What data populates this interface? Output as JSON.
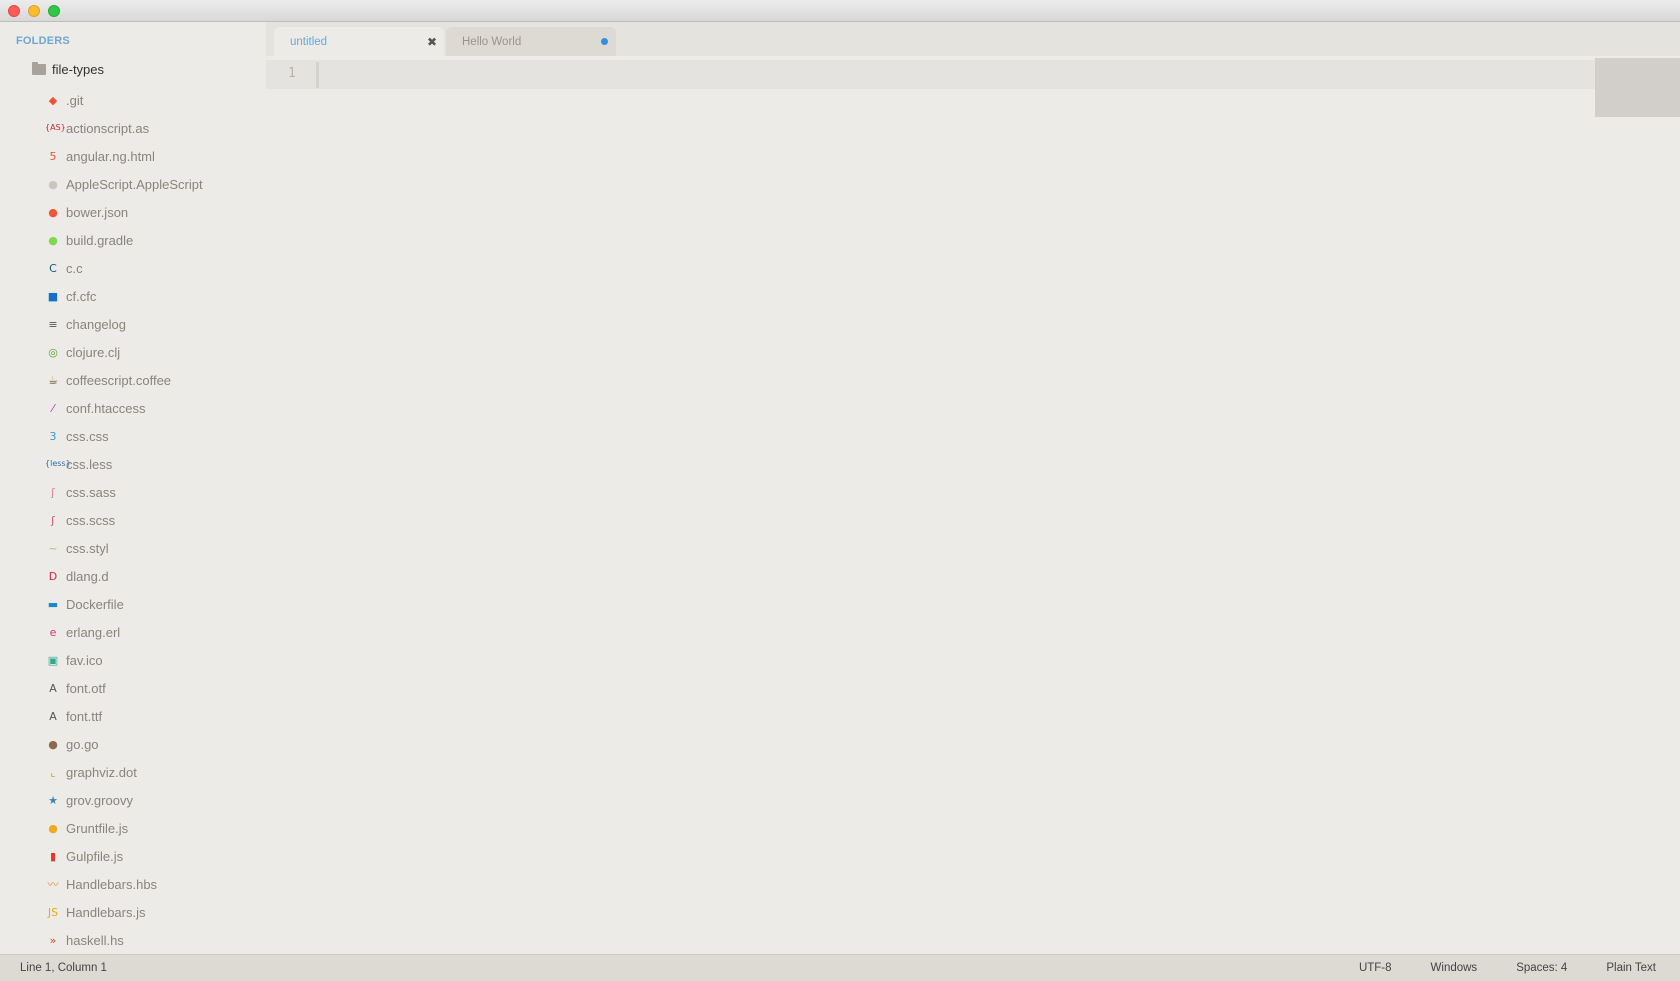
{
  "sidebar": {
    "header": "FOLDERS",
    "root_folder": "file-types",
    "files": [
      {
        "label": ".git",
        "icon": "git-icon",
        "glyph": "◆",
        "color": "#f05033"
      },
      {
        "label": "actionscript.as",
        "icon": "actionscript-icon",
        "glyph": "{AS}",
        "color": "#c1272d"
      },
      {
        "label": "angular.ng.html",
        "icon": "html5-icon",
        "glyph": "5",
        "color": "#e4572e"
      },
      {
        "label": "AppleScript.AppleScript",
        "icon": "apple-icon",
        "glyph": "●",
        "color": "#c9c5bf"
      },
      {
        "label": "bower.json",
        "icon": "bower-icon",
        "glyph": "●",
        "color": "#ef5734"
      },
      {
        "label": "build.gradle",
        "icon": "gradle-icon",
        "glyph": "●",
        "color": "#7dd94f"
      },
      {
        "label": "c.c",
        "icon": "c-icon",
        "glyph": "C",
        "color": "#0f5a8c"
      },
      {
        "label": "cf.cfc",
        "icon": "coldfusion-icon",
        "glyph": "■",
        "color": "#1a6fc4"
      },
      {
        "label": "changelog",
        "icon": "text-lines-icon",
        "glyph": "≡",
        "color": "#555555"
      },
      {
        "label": "clojure.clj",
        "icon": "clojure-icon",
        "glyph": "◎",
        "color": "#5a9f34"
      },
      {
        "label": "coffeescript.coffee",
        "icon": "coffee-icon",
        "glyph": "☕",
        "color": "#7a5230"
      },
      {
        "label": "conf.htaccess",
        "icon": "feather-icon",
        "glyph": "⁄",
        "color": "#c02ad8"
      },
      {
        "label": "css.css",
        "icon": "css3-icon",
        "glyph": "3",
        "color": "#2d9ee0"
      },
      {
        "label": "css.less",
        "icon": "less-icon",
        "glyph": "{less}",
        "color": "#2d6fb7"
      },
      {
        "label": "css.sass",
        "icon": "sass-icon",
        "glyph": "ʃ",
        "color": "#d97aa5"
      },
      {
        "label": "css.scss",
        "icon": "scss-icon",
        "glyph": "ʃ",
        "color": "#c6538c"
      },
      {
        "label": "css.styl",
        "icon": "stylus-icon",
        "glyph": "~",
        "color": "#a9c36a"
      },
      {
        "label": "dlang.d",
        "icon": "dlang-icon",
        "glyph": "D",
        "color": "#c9302c"
      },
      {
        "label": "Dockerfile",
        "icon": "docker-icon",
        "glyph": "▬",
        "color": "#1e88c9"
      },
      {
        "label": "erlang.erl",
        "icon": "erlang-icon",
        "glyph": "e",
        "color": "#d6366f"
      },
      {
        "label": "fav.ico",
        "icon": "image-icon",
        "glyph": "▣",
        "color": "#2ea88f"
      },
      {
        "label": "font.otf",
        "icon": "font-icon",
        "glyph": "A",
        "color": "#555555"
      },
      {
        "label": "font.ttf",
        "icon": "font-icon",
        "glyph": "A",
        "color": "#555555"
      },
      {
        "label": "go.go",
        "icon": "gopher-icon",
        "glyph": "●",
        "color": "#8b6b4a"
      },
      {
        "label": "graphviz.dot",
        "icon": "graph-icon",
        "glyph": "⌞",
        "color": "#c99a2e"
      },
      {
        "label": "grov.groovy",
        "icon": "star-icon",
        "glyph": "★",
        "color": "#3a86b8"
      },
      {
        "label": "Gruntfile.js",
        "icon": "grunt-icon",
        "glyph": "●",
        "color": "#f4a81b"
      },
      {
        "label": "Gulpfile.js",
        "icon": "gulp-icon",
        "glyph": "▮",
        "color": "#e53935"
      },
      {
        "label": "Handlebars.hbs",
        "icon": "mustache-icon",
        "glyph": "〰",
        "color": "#f08a24"
      },
      {
        "label": "Handlebars.js",
        "icon": "js-icon",
        "glyph": "JS",
        "color": "#e8b100"
      },
      {
        "label": "haskell.hs",
        "icon": "haskell-icon",
        "glyph": "»",
        "color": "#d14e1d"
      }
    ]
  },
  "tabs": [
    {
      "label": "untitled",
      "active": true,
      "close": "✖"
    },
    {
      "label": "Hello World",
      "active": false,
      "dirty": true
    }
  ],
  "editor": {
    "line_number": "1"
  },
  "statusbar": {
    "position": "Line 1, Column 1",
    "encoding": "UTF-8",
    "line_endings": "Windows",
    "indentation": "Spaces: 4",
    "syntax": "Plain Text"
  }
}
